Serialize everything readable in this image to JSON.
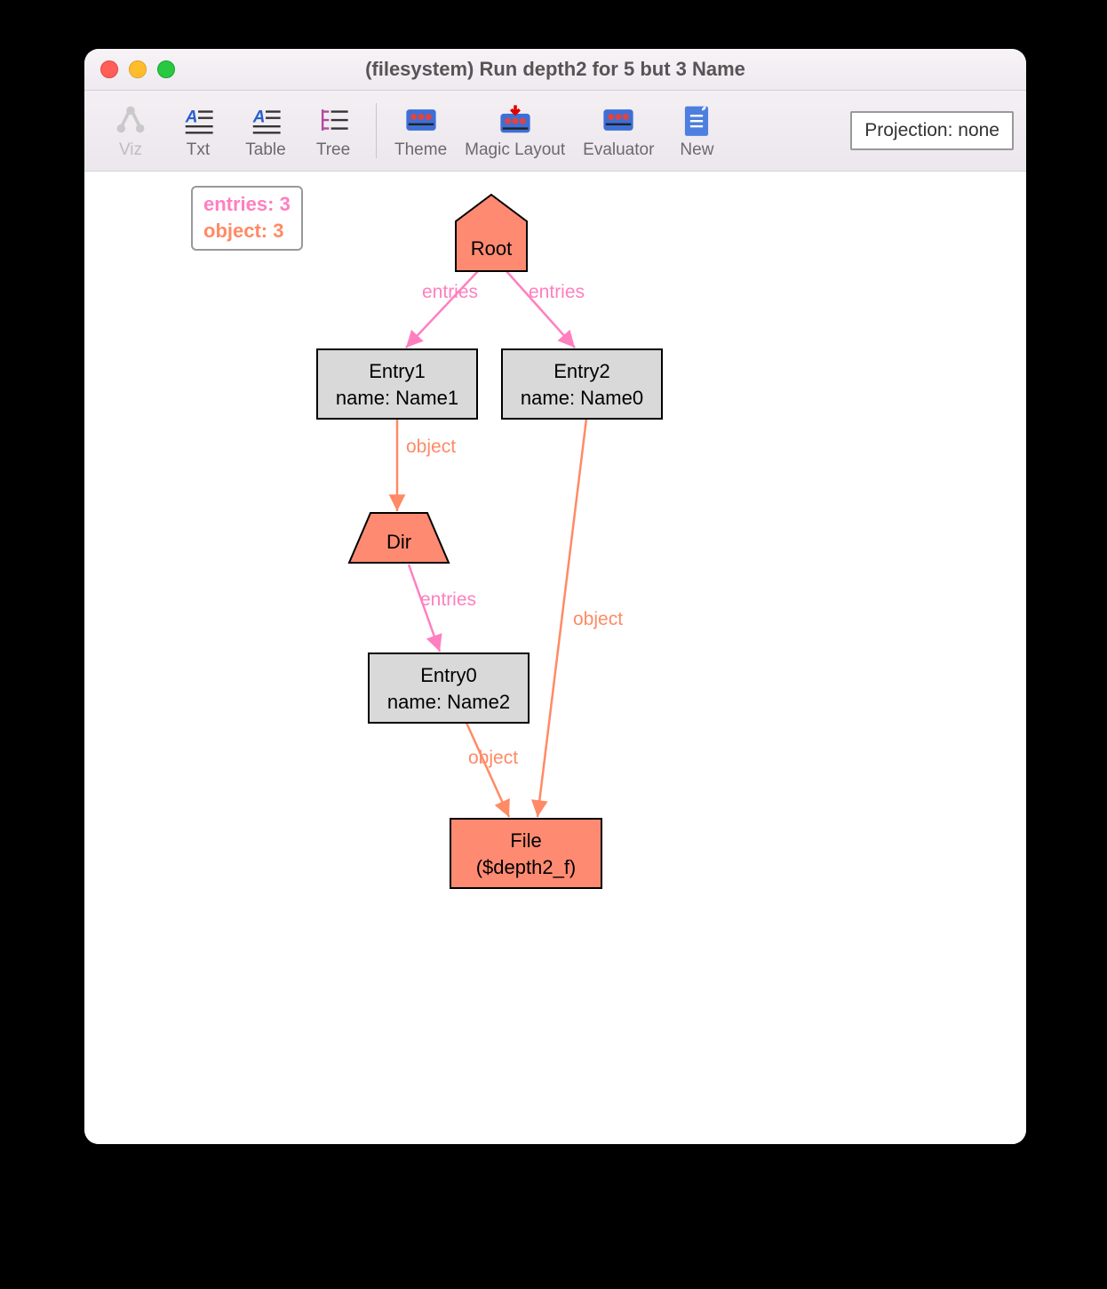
{
  "window": {
    "title": "(filesystem) Run depth2 for 5 but 3 Name"
  },
  "toolbar": {
    "viz": "Viz",
    "txt": "Txt",
    "table": "Table",
    "tree": "Tree",
    "theme": "Theme",
    "magic": "Magic Layout",
    "eval": "Evaluator",
    "new": "New",
    "projection_label": "Projection: none"
  },
  "legend": {
    "entries_label": "entries: 3",
    "object_label": "object: 3"
  },
  "graph": {
    "nodes": {
      "root": {
        "line1": "Root"
      },
      "entry1": {
        "line1": "Entry1",
        "line2": "name: Name1"
      },
      "entry2": {
        "line1": "Entry2",
        "line2": "name: Name0"
      },
      "dir": {
        "line1": "Dir"
      },
      "entry0": {
        "line1": "Entry0",
        "line2": "name: Name2"
      },
      "file": {
        "line1": "File",
        "line2": "($depth2_f)"
      }
    },
    "edge_labels": {
      "root_entry1": "entries",
      "root_entry2": "entries",
      "entry1_dir": "object",
      "dir_entry0": "entries",
      "entry0_file": "object",
      "entry2_file": "object"
    }
  }
}
